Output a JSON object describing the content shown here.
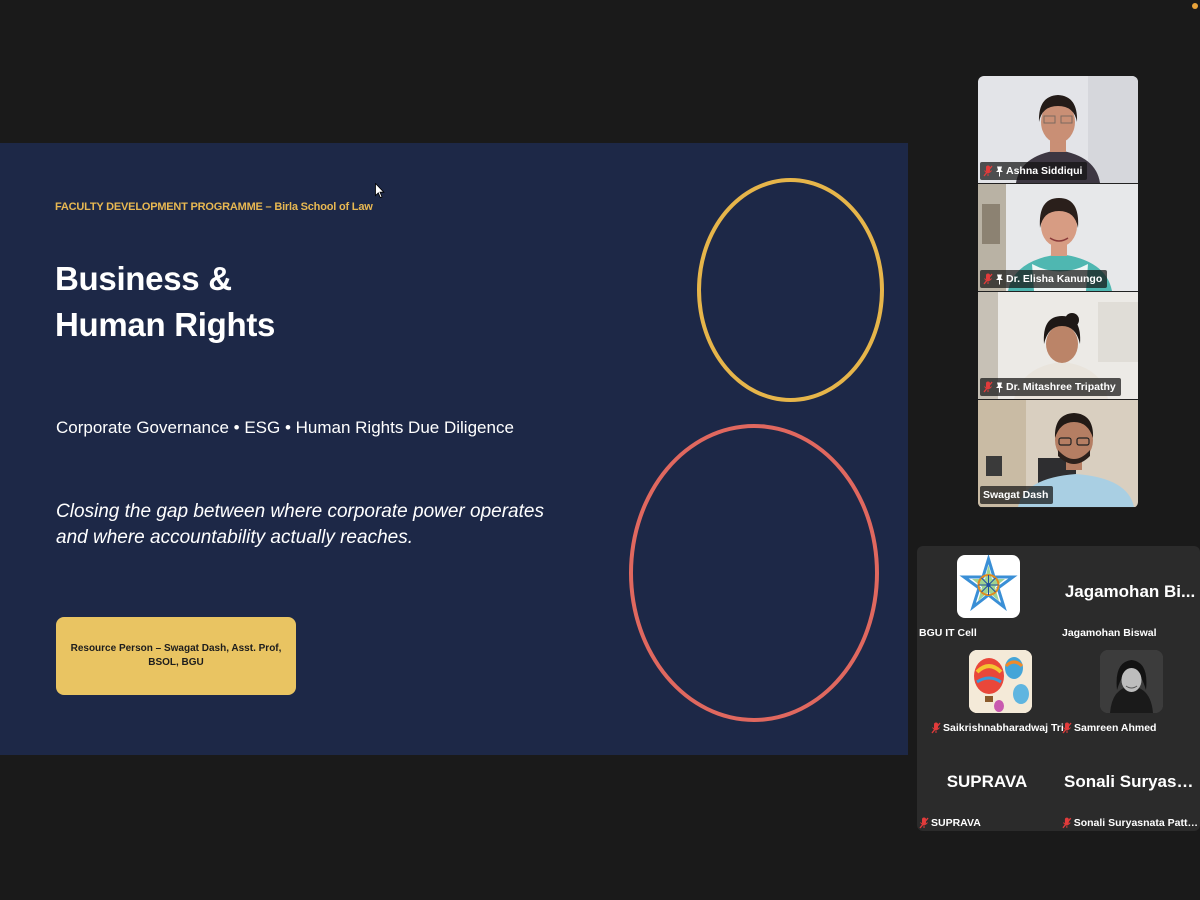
{
  "slide": {
    "eyebrow": "FACULTY DEVELOPMENT PROGRAMME – Birla School of Law",
    "title_line1": "Business &",
    "title_line2": "Human Rights",
    "subtitle": "Corporate Governance • ESG • Human Rights Due Diligence",
    "tagline_line1": "Closing the gap between where corporate power operates",
    "tagline_line2": "and where accountability actually reaches.",
    "resource_person": "Resource Person – Swagat Dash, Asst. Prof, BSOL, BGU",
    "colors": {
      "background": "#1d2847",
      "gold": "#e6b54a",
      "coral": "#e0685f",
      "box": "#e9c462"
    }
  },
  "speakers": [
    {
      "name": "Ashna Siddiqui",
      "muted": true,
      "pinned": true
    },
    {
      "name": "Dr. Elisha Kanungo",
      "muted": true,
      "pinned": true
    },
    {
      "name": "Dr. Mitashree Tripathy",
      "muted": true,
      "pinned": true
    },
    {
      "name": "Swagat Dash",
      "muted": false,
      "pinned": false
    }
  ],
  "gallery": [
    {
      "name": "BGU IT Cell",
      "display": "",
      "avatar": "bgu-logo",
      "muted": false
    },
    {
      "name": "Jagamohan Biswal",
      "display": "Jagamohan Bi...",
      "avatar": "",
      "muted": false
    },
    {
      "name": "Saikrishnabharadwaj Tri",
      "display": "",
      "avatar": "balloons",
      "muted": true
    },
    {
      "name": "Samreen Ahmed",
      "display": "",
      "avatar": "photo",
      "muted": true
    },
    {
      "name": "SUPRAVA",
      "display": "SUPRAVA",
      "avatar": "",
      "muted": true
    },
    {
      "name": "Sonali Suryasnata Patta...",
      "display": "Sonali Suryasn...",
      "avatar": "",
      "muted": true
    }
  ]
}
